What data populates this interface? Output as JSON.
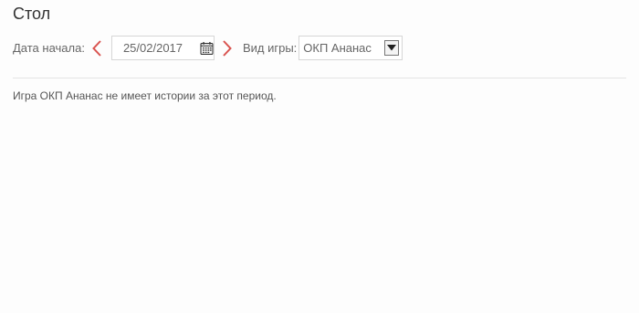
{
  "page": {
    "title": "Стол"
  },
  "filters": {
    "start_date_label": "Дата начала:",
    "start_date_value": "25/02/2017",
    "prev_icon": "chevron-left-icon",
    "next_icon": "chevron-right-icon",
    "calendar_icon": "calendar-icon",
    "game_type_label": "Вид игры:",
    "game_type_selected": "ОКП Ананас",
    "dropdown_icon": "chevron-down-icon"
  },
  "results": {
    "empty_message": "Игра ОКП Ананас не имеет истории за этот период."
  },
  "colors": {
    "accent_arrow": "#d9534f",
    "border": "#d6d6d6",
    "text": "#555555"
  }
}
